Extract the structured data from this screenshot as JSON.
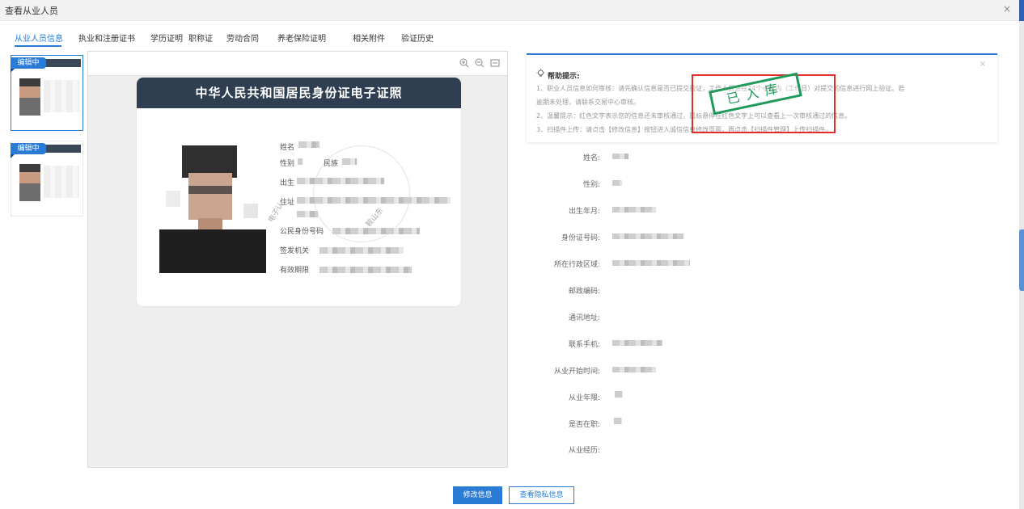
{
  "window": {
    "title": "查看从业人员",
    "close": "×"
  },
  "tabs": [
    {
      "label": "从业人员信息",
      "active": true
    },
    {
      "label": "执业和注册证书",
      "active": false
    },
    {
      "label": "学历证明",
      "active": false
    },
    {
      "label": "职称证",
      "active": false
    },
    {
      "label": "劳动合同",
      "active": false
    },
    {
      "label": "养老保险证明",
      "active": false
    },
    {
      "label": "相关附件",
      "active": false
    },
    {
      "label": "验证历史",
      "active": false
    }
  ],
  "thumbnails": [
    {
      "badge": "编辑中",
      "selected": true
    },
    {
      "badge": "编辑中",
      "selected": false
    }
  ],
  "viewer": {
    "tools": [
      "zoom-in-icon",
      "zoom-out-icon",
      "fit-icon"
    ],
    "card": {
      "title": "中华人民共和国居民身份证电子证照",
      "fields": [
        "姓名",
        "性别",
        "民族",
        "出生",
        "住址",
        "公民身份号码",
        "签发机关",
        "有效期限"
      ],
      "watermark": [
        "电子认",
        "鞍山东"
      ]
    }
  },
  "help": {
    "title": "帮助提示:",
    "close": "×",
    "lines": [
      "1、职业人员信息如何审核：请先确认信息是否已提交验证，工作人员会在24个小时内（工作日）对提交的信息进行网上验证。若",
      "逾期未处理，请联系交易中心审核。",
      "2、温馨提示：红色文字表示您的信息还未审核通过，鼠标悬停在红色文字上可以查看上一次审核通过的信息。",
      "3、扫描件上传：请点击【修改信息】按钮进入诚信信息修改页面，再点击【扫描件管理】上传扫描件。"
    ]
  },
  "stamp": {
    "text": "已入库",
    "color": "#1f9a5a"
  },
  "info_fields": [
    {
      "label": "姓名:",
      "has_value": true
    },
    {
      "label": "性别:",
      "has_value": true
    },
    {
      "label": "出生年月:",
      "has_value": true
    },
    {
      "label": "身份证号码:",
      "has_value": true
    },
    {
      "label": "所在行政区域:",
      "has_value": true
    },
    {
      "label": "邮政编码:",
      "has_value": false
    },
    {
      "label": "通讯地址:",
      "has_value": false
    },
    {
      "label": "联系手机:",
      "has_value": true
    },
    {
      "label": "从业开始时间:",
      "has_value": true
    },
    {
      "label": "从业年限:",
      "has_value": true
    },
    {
      "label": "是否在职:",
      "has_value": true
    },
    {
      "label": "从业经历:",
      "has_value": false
    }
  ],
  "buttons": {
    "edit": "修改信息",
    "view_private": "查看隐私信息"
  },
  "colors": {
    "accent": "#2a7bd6",
    "card_header": "#2f3e50",
    "stamp_border": "#e22b2b"
  }
}
